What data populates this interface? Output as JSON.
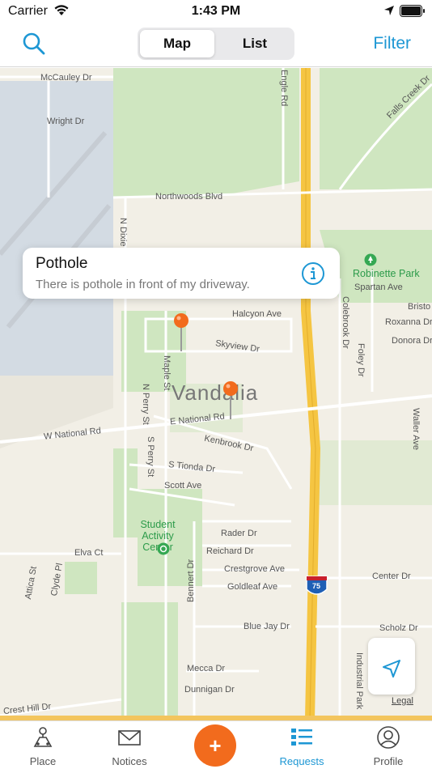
{
  "status_bar": {
    "carrier": "Carrier",
    "time": "1:43 PM"
  },
  "nav": {
    "segments": [
      "Map",
      "List"
    ],
    "active_segment": "Map",
    "filter_label": "Filter"
  },
  "map": {
    "city": "Vandalia",
    "streets": {
      "mccauley": "McCauley Dr",
      "wright": "Wright Dr",
      "engle": "Engle Rd",
      "falls_creek": "Falls Creek Dr",
      "northwoods": "Northwoods Blvd",
      "n_dixie": "N Dixie",
      "spartan": "Spartan Ave",
      "bristol": "Bristo",
      "roxanna": "Roxanna Dr",
      "donora": "Donora Dr",
      "halcyon": "Halcyon Ave",
      "skyview": "Skyview Dr",
      "colebrook": "Colebrook Dr",
      "foley": "Foley Dr",
      "maple": "Maple St",
      "n_perry": "N Perry St",
      "e_national": "E National Rd",
      "w_national": "W National Rd",
      "waller": "Waller Ave",
      "kenbrook": "Kenbrook Dr",
      "s_perry": "S Perry St",
      "s_tionda": "S Tionda Dr",
      "scott": "Scott Ave",
      "rader": "Rader Dr",
      "reichard": "Reichard Dr",
      "crestgrove": "Crestgrove Ave",
      "goldleaf": "Goldleaf Ave",
      "center": "Center Dr",
      "attica": "Attica St",
      "clyde": "Clyde Pl",
      "elva": "Elva Ct",
      "bennert": "Bennert Dr",
      "blue_jay": "Blue Jay Dr",
      "scholz": "Scholz Dr",
      "industrial": "Industrial Park",
      "mecca": "Mecca Dr",
      "dunnigan": "Dunnigan Dr",
      "crest_hill": "Crest Hill Dr"
    },
    "places": {
      "park": "Robinette Park",
      "student_center": "Student Activity Center",
      "interstate": "75"
    },
    "legal": "Legal",
    "callout": {
      "title": "Pothole",
      "description": "There is pothole in front of my driveway."
    }
  },
  "tabs": [
    {
      "label": "Place",
      "icon": "place-icon"
    },
    {
      "label": "Notices",
      "icon": "mail-icon"
    },
    {
      "label": "+",
      "icon": "add-icon"
    },
    {
      "label": "Requests",
      "icon": "requests-icon",
      "active": true
    },
    {
      "label": "Profile",
      "icon": "profile-icon"
    }
  ],
  "colors": {
    "accent": "#1d97d4",
    "fab": "#f26b1d",
    "pin": "#f26b1d",
    "highway": "#f5c542",
    "park": "#cfe6c0",
    "water": "#d3dbe3"
  }
}
